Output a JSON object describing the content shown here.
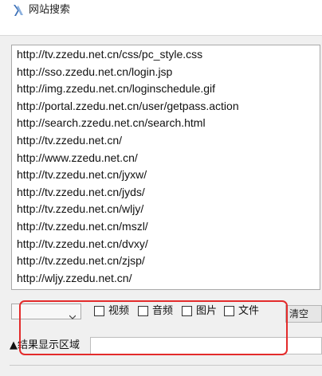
{
  "window": {
    "title": "网站搜索"
  },
  "url_list": {
    "items": [
      "http://tv.zzedu.net.cn/css/pc_style.css",
      "http://sso.zzedu.net.cn/login.jsp",
      "http://img.zzedu.net.cn/loginschedule.gif",
      "http://portal.zzedu.net.cn/user/getpass.action",
      "http://search.zzedu.net.cn/search.html",
      "http://tv.zzedu.net.cn/",
      "http://www.zzedu.net.cn/",
      "http://tv.zzedu.net.cn/jyxw/",
      "http://tv.zzedu.net.cn/jyds/",
      "http://tv.zzedu.net.cn/wljy/",
      "http://tv.zzedu.net.cn/mszl/",
      "http://tv.zzedu.net.cn/dvxy/",
      "http://tv.zzedu.net.cn/zjsp/",
      "http://wljy.zzedu.net.cn/"
    ]
  },
  "filters": {
    "video": "视频",
    "audio": "音频",
    "image": "图片",
    "file": "文件"
  },
  "clear_label": "清空",
  "result": {
    "label": "▲结果显示区域",
    "value": ""
  },
  "colors": {
    "highlight": "#e32b2b"
  }
}
